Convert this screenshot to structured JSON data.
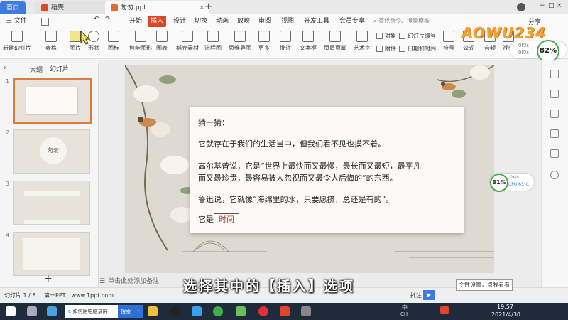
{
  "tabs": {
    "home": "首页",
    "docer": "稻壳",
    "ppt": "匆匆.ppt",
    "add": "+"
  },
  "menu": {
    "file": "三 文件",
    "items": [
      "开始",
      "插入",
      "设计",
      "切换",
      "动画",
      "放映",
      "审阅",
      "视图",
      "开发工具",
      "会员专享"
    ],
    "active": "插入",
    "search_placeholder": "查找命令、搜索模板",
    "share": "分享"
  },
  "ribbon": {
    "big": [
      "新建幻灯片",
      "表格",
      "图片",
      "形状",
      "图标",
      "智能图形",
      "图表",
      "稻壳素材",
      "流程图",
      "思维导图",
      "更多",
      "批注",
      "文本框",
      "页眉页脚",
      "艺术字",
      "符号",
      "公式",
      "音频",
      "视频"
    ],
    "small": [
      "对象",
      "幻灯片编号",
      "附件",
      "日期和时间"
    ]
  },
  "left_panel": {
    "tab_outline": "大纲",
    "tab_slides": "幻灯片",
    "slide_numbers": [
      "1",
      "2",
      "3",
      "4"
    ],
    "thumb2_title": "匆匆",
    "add": "+"
  },
  "slide": {
    "lines": [
      "猜一猜：",
      "它就存在于我们的生活当中，但我们看不见也摸不着。",
      "高尔基曾说，它是“世界上最快而又最慢，最长而又最短，最平凡",
      "而又最珍贵，最容易被人忽视而又最令人后悔的”的东西。",
      "鲁迅说，它就像“海绵里的水，只要愿挤，总还是有的”。"
    ],
    "answer_prefix": "它是",
    "answer": "时间"
  },
  "notes_placeholder": "单击此处添加备注",
  "status": {
    "slide_count": "幻灯片 1 / 8",
    "theme": "第一PPT，www.1ppt.com",
    "comment": "批注"
  },
  "subtitle": "选择其中的【插入】选项",
  "tooltip": "个性设置，点我看看",
  "gauges": {
    "top": "82%",
    "mid": "81%",
    "speed_up": "0K/s",
    "speed_down": "0K/s",
    "mid_speed": "0K/s",
    "cpu": "CPU 63°C"
  },
  "taskbar": {
    "browser_label": "如何用电脑录屏",
    "search_btn": "搜索一下",
    "time": "19:57",
    "date": "2021/4/30",
    "lang": "中",
    "ime": "CH"
  },
  "watermark": "AOWU234",
  "colors": {
    "accent": "#e0452b",
    "home_tab": "#3d7be0",
    "answer": "#c0392b",
    "taskbar": "#1f2b3a"
  }
}
